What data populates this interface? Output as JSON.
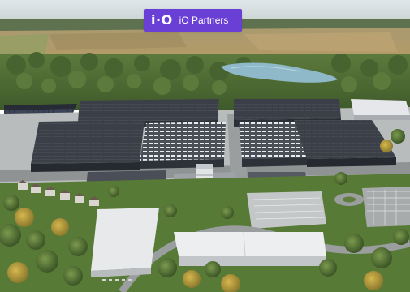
{
  "logo": {
    "mark": "i·O",
    "name": "iO Partners"
  },
  "colors": {
    "brand": "#6a3fd6",
    "roof_dark": "#3c4049",
    "roof_light": "#e6e7ea",
    "forest": "#4e6b34",
    "field": "#b89e6b",
    "lake": "#8fb8c8"
  }
}
